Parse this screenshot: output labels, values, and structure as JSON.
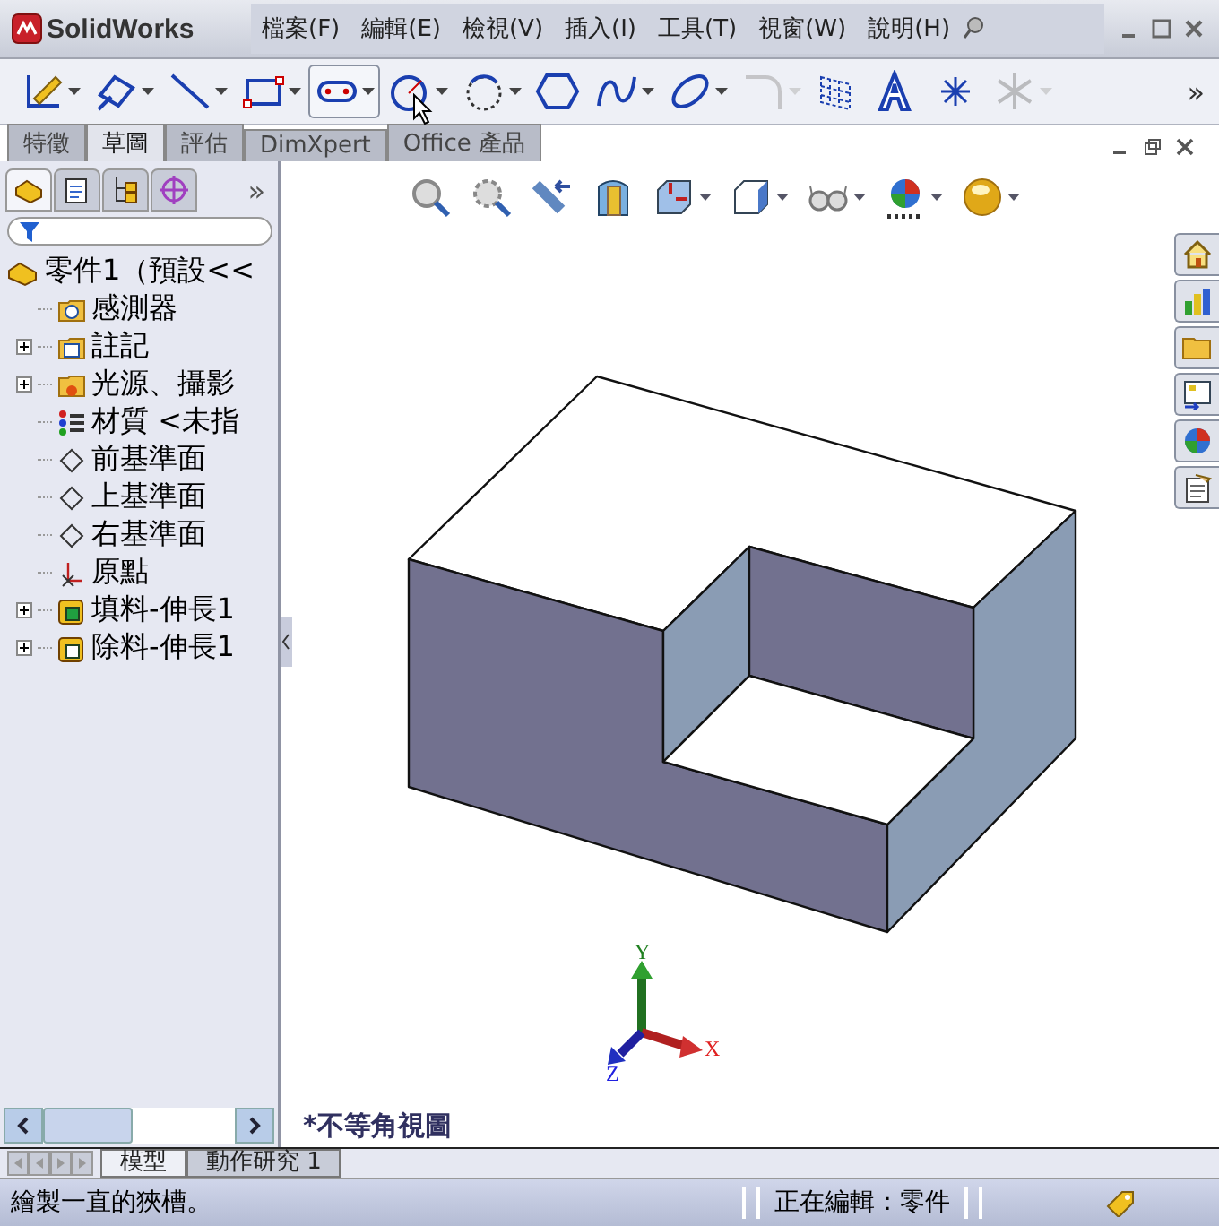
{
  "title_bar": {
    "logo": "SolidWorks",
    "menu": [
      "檔案(F)",
      "編輯(E)",
      "檢視(V)",
      "插入(I)",
      "工具(T)",
      "視窗(W)",
      "說明(H)"
    ]
  },
  "toolbar": {
    "overflow": "»",
    "tools": [
      {
        "kind": "sketch",
        "dropdown": true,
        "disabled": false,
        "highlighted": false
      },
      {
        "kind": "dimension",
        "dropdown": true,
        "disabled": false,
        "highlighted": false
      },
      {
        "kind": "line",
        "dropdown": true,
        "disabled": false,
        "highlighted": false
      },
      {
        "kind": "rectangle",
        "dropdown": true,
        "disabled": false,
        "highlighted": false
      },
      {
        "kind": "slot",
        "dropdown": true,
        "disabled": false,
        "highlighted": true
      },
      {
        "kind": "circle",
        "dropdown": true,
        "disabled": false,
        "highlighted": false
      },
      {
        "kind": "arc",
        "dropdown": true,
        "disabled": false,
        "highlighted": false
      },
      {
        "kind": "polygon",
        "dropdown": false,
        "disabled": false,
        "highlighted": false
      },
      {
        "kind": "spline",
        "dropdown": true,
        "disabled": false,
        "highlighted": false
      },
      {
        "kind": "ellipse",
        "dropdown": true,
        "disabled": false,
        "highlighted": false
      },
      {
        "kind": "fillet",
        "dropdown": true,
        "disabled": true,
        "highlighted": false
      },
      {
        "kind": "grid",
        "dropdown": false,
        "disabled": false,
        "highlighted": false
      },
      {
        "kind": "text",
        "dropdown": false,
        "disabled": false,
        "highlighted": false
      },
      {
        "kind": "point",
        "dropdown": false,
        "disabled": false,
        "highlighted": false
      },
      {
        "kind": "trim",
        "dropdown": true,
        "disabled": true,
        "highlighted": false
      }
    ]
  },
  "command_tabs": [
    {
      "label": "特徵",
      "selected": false
    },
    {
      "label": "草圖",
      "selected": true
    },
    {
      "label": "評估",
      "selected": false
    },
    {
      "label": "DimXpert",
      "selected": false
    },
    {
      "label": "Office 產品",
      "selected": false
    }
  ],
  "panel": {
    "overflow": "»",
    "tabs": [
      {
        "kind": "feature",
        "selected": true
      },
      {
        "kind": "property",
        "selected": false
      },
      {
        "kind": "config",
        "selected": false
      },
      {
        "kind": "target",
        "selected": false
      }
    ],
    "tree": {
      "label": "零件1（預設<<",
      "children": [
        {
          "label": "感測器",
          "kind": "sensor",
          "expandable": false
        },
        {
          "label": "註記",
          "kind": "annotation",
          "expandable": true
        },
        {
          "label": "光源、攝影",
          "kind": "light",
          "expandable": true
        },
        {
          "label": "材質 <未指",
          "kind": "material",
          "expandable": false
        },
        {
          "label": "前基準面",
          "kind": "plane",
          "expandable": false
        },
        {
          "label": "上基準面",
          "kind": "plane",
          "expandable": false
        },
        {
          "label": "右基準面",
          "kind": "plane",
          "expandable": false
        },
        {
          "label": "原點",
          "kind": "origin",
          "expandable": false
        },
        {
          "label": "填料-伸長1",
          "kind": "boss",
          "expandable": true
        },
        {
          "label": "除料-伸長1",
          "kind": "cut",
          "expandable": true
        }
      ]
    }
  },
  "viewport": {
    "view_label": "*不等角視圖",
    "triad": {
      "x": "X",
      "y": "Y",
      "z": "Z"
    }
  },
  "bottom_tabs": [
    {
      "label": "模型",
      "selected": true
    },
    {
      "label": "動作研究 1",
      "selected": false
    }
  ],
  "status_bar": {
    "message": "繪製一直的狹槽。",
    "mode": "正在編輯：零件"
  }
}
